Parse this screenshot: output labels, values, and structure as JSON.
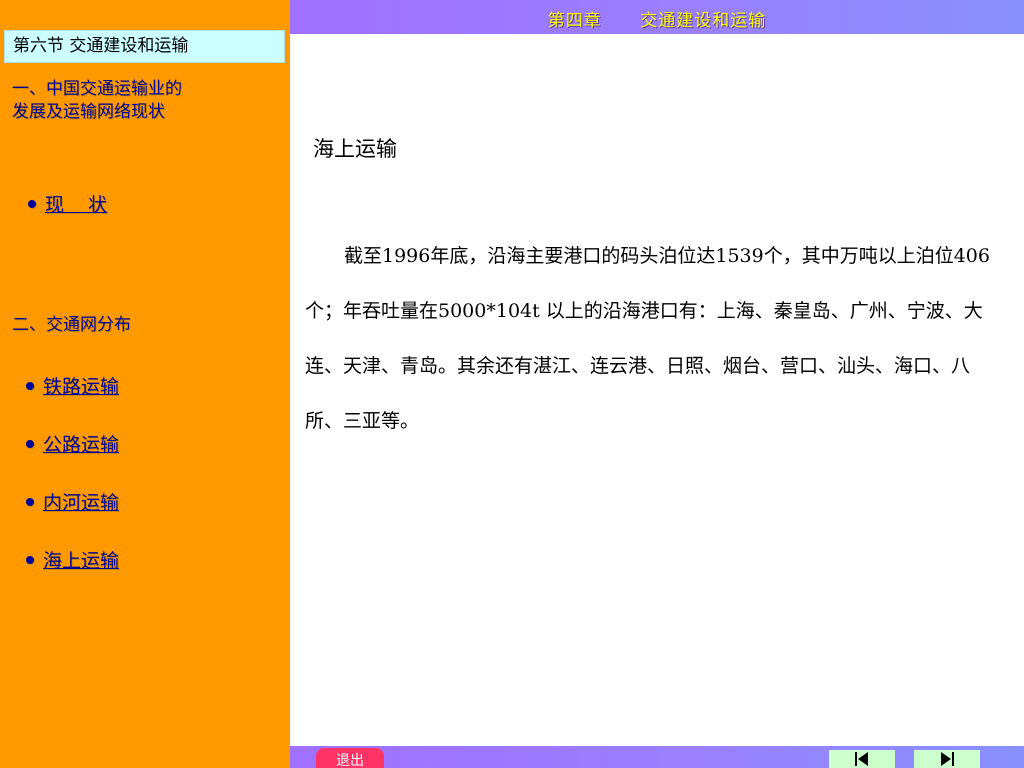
{
  "sidebar": {
    "section_title": "第六节  交通建设和运输",
    "heading1_line1": "一、中国交通运输业的",
    "heading1_line2": "发展及运输网络现状",
    "item_status": "现    状",
    "heading2": "二、交通网分布",
    "items": [
      {
        "label": "铁路运输"
      },
      {
        "label": "公路运输"
      },
      {
        "label": "内河运输"
      },
      {
        "label": "海上运输"
      }
    ]
  },
  "header": {
    "chapter_title": "第四章      交通建设和运输"
  },
  "main": {
    "title": "海上运输",
    "paragraph": "截至1996年底，沿海主要港口的码头泊位达1539个，其中万吨以上泊位406个；年吞吐量在5000*104t 以上的沿海港口有：上海、秦皇岛、广州、宁波、大连、天津、青岛。其余还有湛江、连云港、日照、烟台、营口、汕头、海口、八所、三亚等。"
  },
  "footer": {
    "exit_label": "退出",
    "first_icon": "skip-to-start-icon",
    "last_icon": "skip-to-end-icon"
  },
  "colors": {
    "sidebar_bg": "#ff9900",
    "section_box_bg": "#ccffff",
    "link_color": "#000099",
    "bar_gradient_start": "#a070ff",
    "bar_gradient_end": "#8890ff",
    "chapter_title_color": "#ffff00",
    "exit_button_bg": "#ff3366",
    "nav_button_bg": "#ccffcc"
  }
}
